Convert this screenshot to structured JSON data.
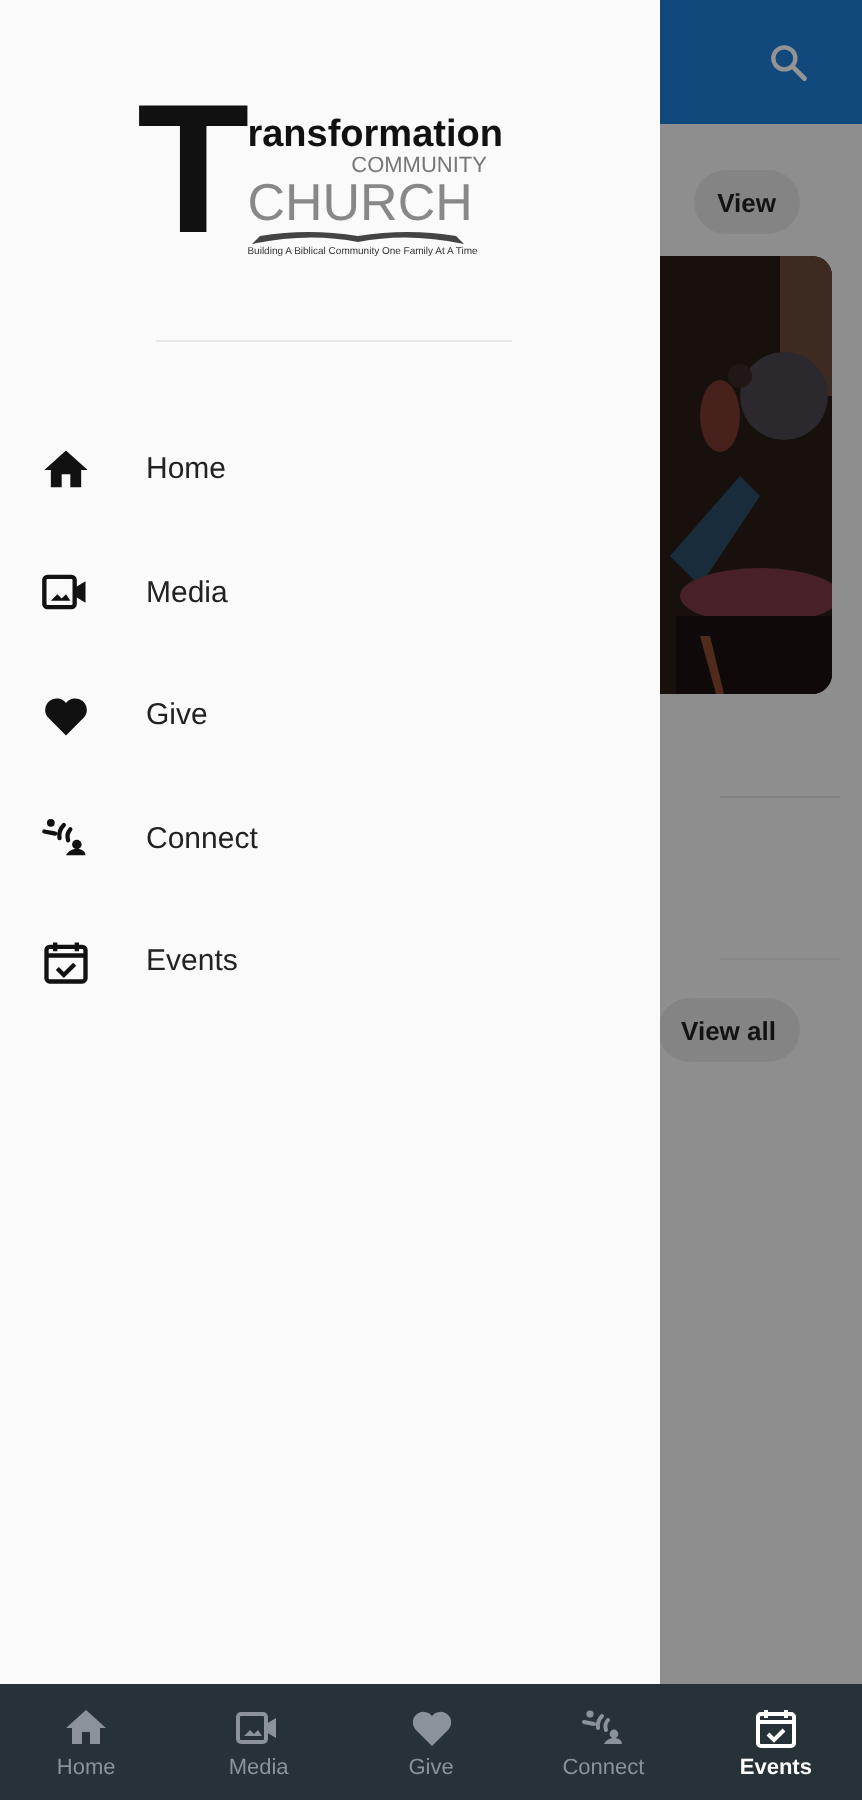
{
  "drawer": {
    "logo": {
      "title": "Transformation",
      "subtitle": "COMMUNITY",
      "name": "CHURCH",
      "tagline": "Building A Biblical Community One Family At A Time"
    },
    "items": [
      {
        "kind": "home",
        "label": "Home"
      },
      {
        "kind": "media",
        "label": "Media"
      },
      {
        "kind": "give",
        "label": "Give"
      },
      {
        "kind": "connect",
        "label": "Connect"
      },
      {
        "kind": "events",
        "label": "Events"
      }
    ]
  },
  "background": {
    "view_button": "View",
    "view_all_button": "View all"
  },
  "bottom_nav": [
    {
      "kind": "home",
      "label": "Home",
      "selected": false
    },
    {
      "kind": "media",
      "label": "Media",
      "selected": false
    },
    {
      "kind": "give",
      "label": "Give",
      "selected": false
    },
    {
      "kind": "connect",
      "label": "Connect",
      "selected": false
    },
    {
      "kind": "events",
      "label": "Events",
      "selected": true
    }
  ]
}
